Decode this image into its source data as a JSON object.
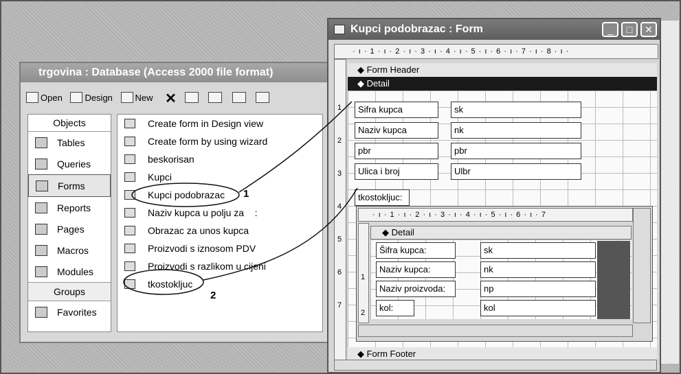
{
  "db_window": {
    "title": "trgovina : Database (Access 2000 file format)",
    "toolbar": {
      "open": "Open",
      "design": "Design",
      "new": "New",
      "delete_icon": "close-x-icon"
    },
    "objects_header": "Objects",
    "objects": [
      {
        "label": "Tables",
        "icon": "table-icon"
      },
      {
        "label": "Queries",
        "icon": "query-icon"
      },
      {
        "label": "Forms",
        "icon": "form-icon",
        "selected": true
      },
      {
        "label": "Reports",
        "icon": "report-icon"
      },
      {
        "label": "Pages",
        "icon": "page-icon"
      },
      {
        "label": "Macros",
        "icon": "macro-icon"
      },
      {
        "label": "Modules",
        "icon": "module-icon"
      }
    ],
    "groups_header": "Groups",
    "groups": [
      {
        "label": "Favorites",
        "icon": "favorites-icon"
      }
    ],
    "items": [
      "Create form in Design view",
      "Create form by using wizard",
      "beskorisan",
      "Kupci",
      "Kupci podobrazac",
      "Naziv kupca u polju za    :",
      "Obrazac za unos kupca",
      "Proizvodi s iznosom PDV",
      "Proizvodi s razlikom u cijeni",
      "tkostokljuc"
    ]
  },
  "callouts": {
    "one": "1",
    "two": "2"
  },
  "form_window": {
    "title": "Kupci podobrazac : Form",
    "ruler": "· ı · 1 · ı · 2 · ı · 3 · ı · 4 · ı · 5 · ı · 6 · ı · 7 · ı · 8 · ı ·",
    "vruler": [
      "1",
      "2",
      "3",
      "4",
      "5",
      "6",
      "7"
    ],
    "form_header": "Form Header",
    "detail": "Detail",
    "form_footer": "Form Footer",
    "labels": [
      "Sifra kupca",
      "Naziv kupca",
      "pbr",
      "Ulica i broj"
    ],
    "fields": [
      "sk",
      "nk",
      "pbr",
      "Ulbr"
    ],
    "subform_label": "tkostokljuc:",
    "subform": {
      "ruler": "· ı · 1 · ı · 2 · ı · 3 · ı · 4 · ı · 5 · ı · 6 · ı · 7",
      "vruler": [
        "1",
        "2"
      ],
      "detail": "Detail",
      "labels": [
        "Šifra kupca:",
        "Naziv kupca:",
        "Naziv proizvoda:",
        "kol:"
      ],
      "fields": [
        "sk",
        "nk",
        "np",
        "kol"
      ]
    }
  }
}
